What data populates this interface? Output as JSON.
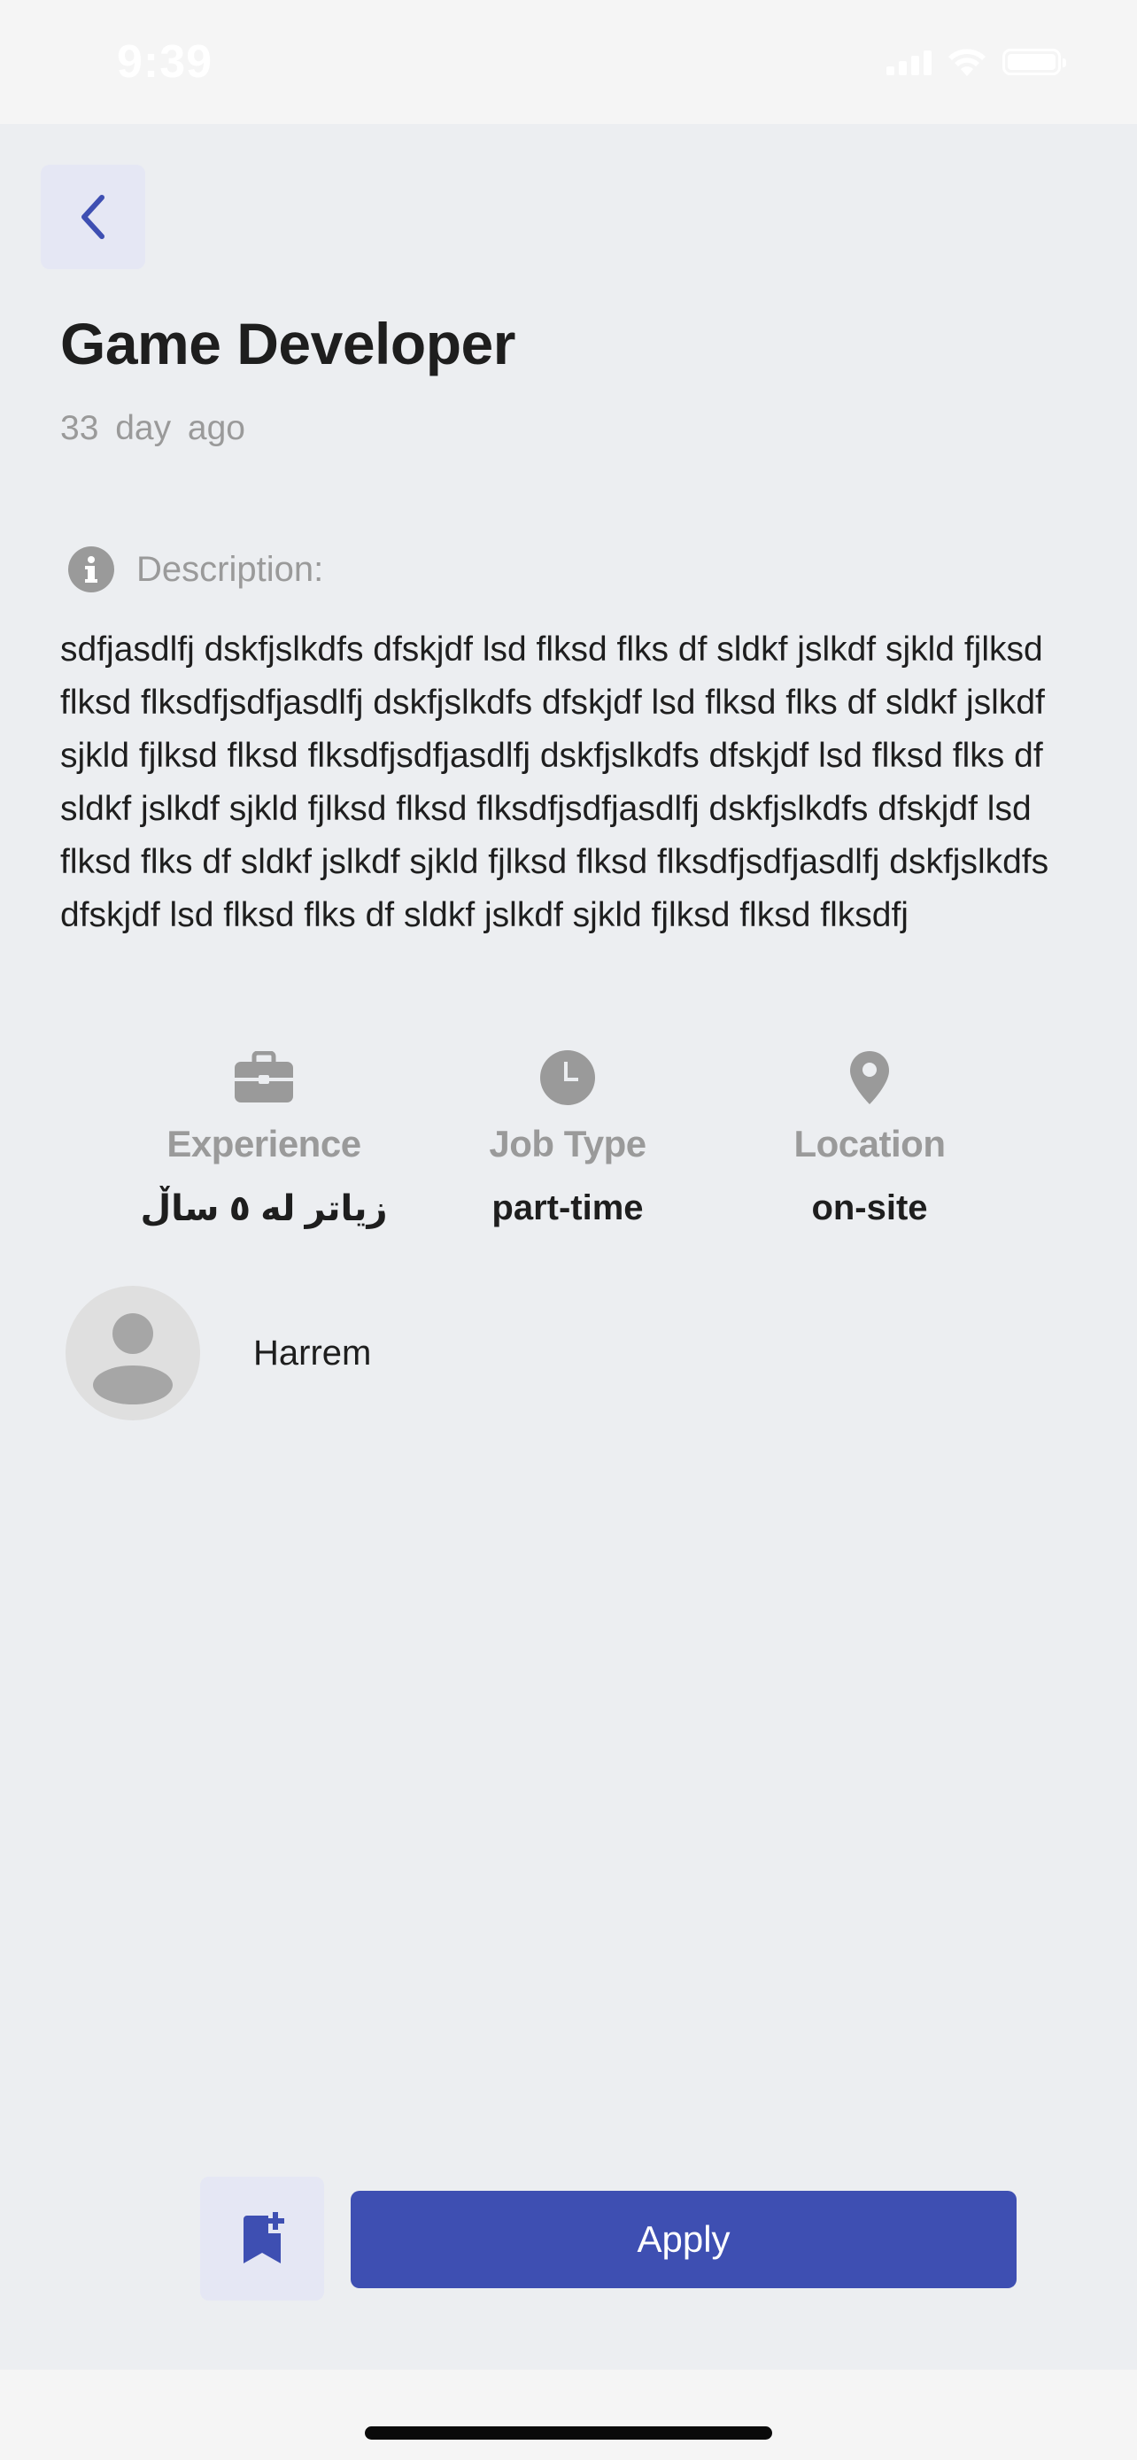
{
  "status_bar": {
    "time": "9:39"
  },
  "header": {
    "back_icon": "chevron-left-icon",
    "title": "Game Developer",
    "posted": "33 day  ago"
  },
  "description": {
    "icon": "info-icon",
    "label": "Description:",
    "text": "sdfjasdlfj dskfjslkdfs dfskjdf lsd flksd flks df sldkf jslkdf sjkld fjlksd flksd flksdfjsdfjasdlfj dskfjslkdfs dfskjdf lsd flksd flks df sldkf jslkdf sjkld fjlksd flksd flksdfjsdfjasdlfj dskfjslkdfs dfskjdf lsd flksd flks df sldkf jslkdf sjkld fjlksd flksd flksdfjsdfjasdlfj dskfjslkdfs dfskjdf lsd flksd flks df sldkf jslkdf sjkld fjlksd flksd flksdfjsdfjasdlfj dskfjslkdfs dfskjdf lsd flksd flks df sldkf jslkdf sjkld fjlksd flksd flksdfj"
  },
  "info": [
    {
      "icon": "briefcase-icon",
      "label": "Experience",
      "value": "زیاتر لە ٥ ساڵ"
    },
    {
      "icon": "clock-icon",
      "label": "Job Type",
      "value": "part-time"
    },
    {
      "icon": "location-pin-icon",
      "label": "Location",
      "value": "on-site"
    }
  ],
  "poster": {
    "avatar_icon": "user-avatar-icon",
    "name": "Harrem"
  },
  "actions": {
    "bookmark_icon": "bookmark-add-icon",
    "apply_label": "Apply"
  },
  "colors": {
    "background": "#ECEEF1",
    "accent": "#3E4FB2",
    "accent_light": "#E5E7F4",
    "text_primary": "#1E1E1E",
    "text_secondary": "#9A9A9A"
  }
}
